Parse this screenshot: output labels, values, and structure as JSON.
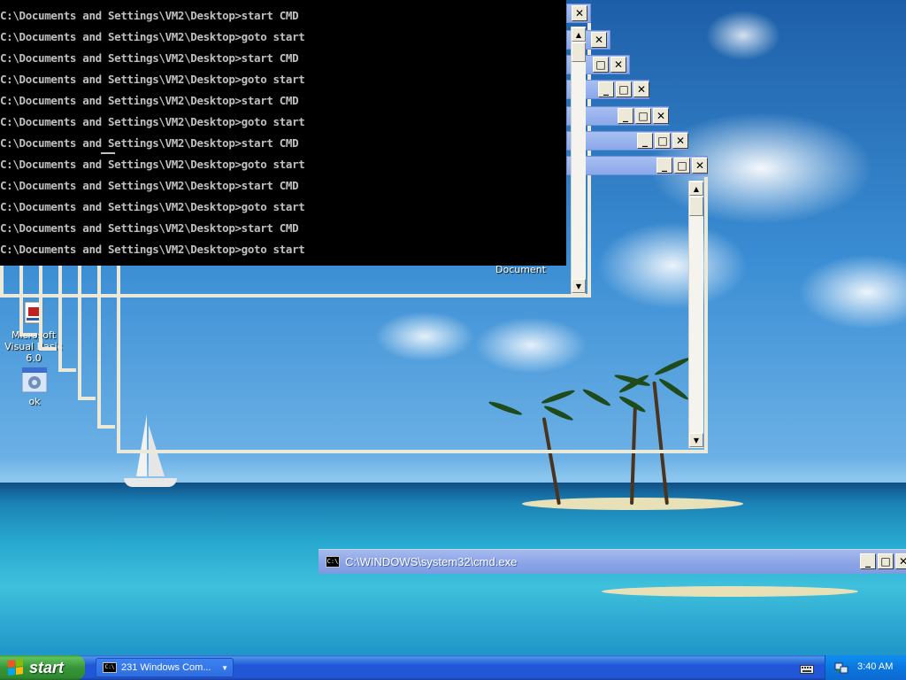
{
  "console": {
    "lines": [
      "C:\\Documents and Settings\\VM2\\Desktop>start CMD",
      "C:\\Documents and Settings\\VM2\\Desktop>goto start",
      "C:\\Documents and Settings\\VM2\\Desktop>start CMD",
      "C:\\Documents and Settings\\VM2\\Desktop>goto start",
      "C:\\Documents and Settings\\VM2\\Desktop>start CMD",
      "C:\\Documents and Settings\\VM2\\Desktop>goto start",
      "C:\\Documents and Settings\\VM2\\Desktop>start CMD",
      "C:\\Documents and Settings\\VM2\\Desktop>goto start",
      "C:\\Documents and Settings\\VM2\\Desktop>start CMD",
      "C:\\Documents and Settings\\VM2\\Desktop>goto start",
      "C:\\Documents and Settings\\VM2\\Desktop>start CMD",
      "C:\\Documents and Settings\\VM2\\Desktop>goto start"
    ]
  },
  "desktop_icons": {
    "vb_label": "Microsoft Visual Basic 6.0",
    "ok_label": "ok",
    "document_label": "Document"
  },
  "window_controls": {
    "minimize": "_",
    "maximize": "□",
    "close": "✕",
    "scroll_up": "▲",
    "scroll_down": "▼"
  },
  "cmd_window": {
    "title": "C:\\WINDOWS\\system32\\cmd.exe",
    "icon_text": "C:\\"
  },
  "taskbar": {
    "start_label": "start",
    "task_label": "231 Windows Com...",
    "task_icon_text": "C:\\",
    "clock": "3:40 AM"
  },
  "colors": {
    "taskbar_blue": "#2157d7",
    "start_green": "#379637",
    "tray_blue": "#0b77e0",
    "titlebar_inactive": "#8aa8e8",
    "window_frame": "#ece9d8"
  }
}
